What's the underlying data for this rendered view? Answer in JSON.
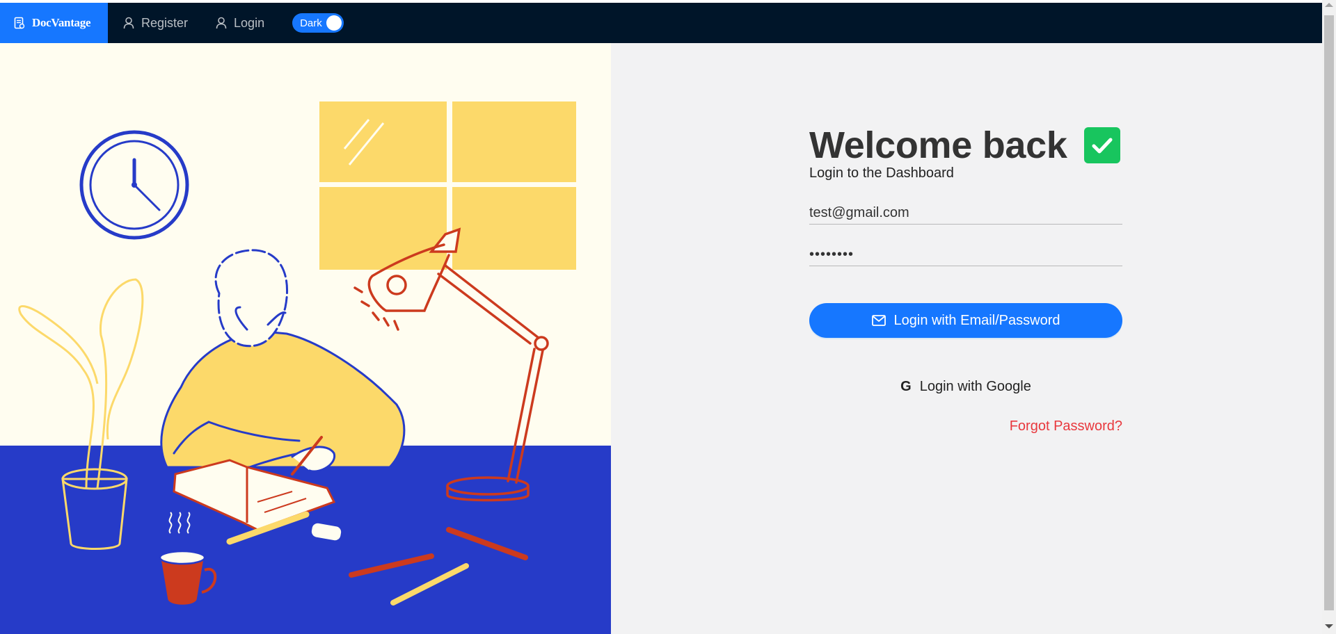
{
  "nav": {
    "brand": "DocVantage",
    "register": "Register",
    "login": "Login",
    "theme_toggle_label": "Dark"
  },
  "login": {
    "title": "Welcome back",
    "subtitle": "Login to the Dashboard",
    "email_value": "test@gmail.com",
    "password_value": "••••••••",
    "email_button": "Login with Email/Password",
    "google_button": "Login with Google",
    "forgot_link": "Forgot Password?"
  },
  "colors": {
    "navbar": "#001529",
    "primary": "#1677ff",
    "success": "#18c55e",
    "danger": "#e8383d",
    "illustration_wall": "#fffdf0",
    "illustration_desk": "#263bc8",
    "illustration_yellow": "#fcd96a",
    "illustration_red": "#cc3a1e"
  },
  "icons": {
    "brand": "document-icon",
    "register": "user-icon",
    "login": "user-icon",
    "email_button": "mail-icon",
    "google_button": "google-icon",
    "title_badge": "check-icon"
  }
}
